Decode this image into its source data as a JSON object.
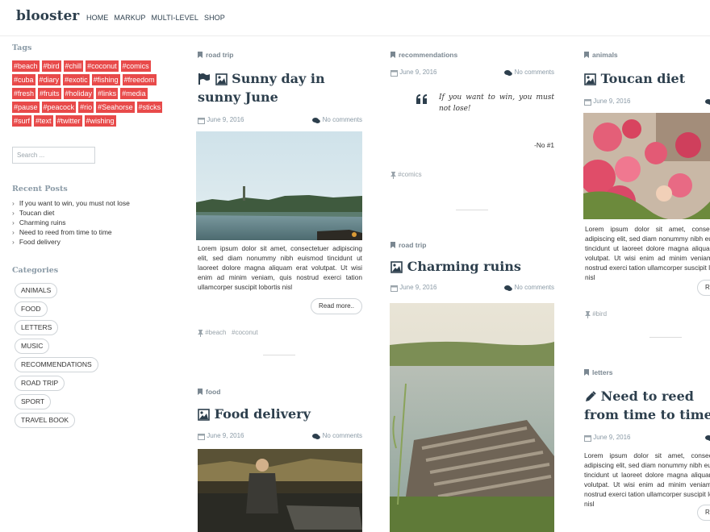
{
  "site": {
    "title": "blooster"
  },
  "nav": [
    "HOME",
    "MARKUP",
    "MULTI-LEVEL",
    "SHOP"
  ],
  "sidebar": {
    "tags_title": "Tags",
    "tags": [
      "#beach",
      "#bird",
      "#chill",
      "#coconut",
      "#comics",
      "#cuba",
      "#diary",
      "#exotic",
      "#fishing",
      "#freedom",
      "#fresh",
      "#fruits",
      "#holiday",
      "#links",
      "#media",
      "#pause",
      "#peacock",
      "#rio",
      "#Seahorse",
      "#sticks",
      "#surf",
      "#text",
      "#twitter",
      "#wishing"
    ],
    "search_placeholder": "Search ...",
    "recent_title": "Recent Posts",
    "recent_posts": [
      "If you want to win, you must not lose",
      "Toucan diet",
      "Charming ruins",
      "Need to reed from time to time",
      "Food delivery"
    ],
    "categories_title": "Categories",
    "categories": [
      "ANIMALS",
      "FOOD",
      "LETTERS",
      "MUSIC",
      "RECOMMENDATIONS",
      "ROAD TRIP",
      "SPORT",
      "TRAVEL BOOK"
    ]
  },
  "posts": {
    "sunny": {
      "category": "road trip",
      "title": "Sunny day in sunny June",
      "date": "June 9, 2016",
      "comments": "No comments",
      "excerpt": "Lorem ipsum dolor sit amet, consectetuer adipiscing elit, sed diam nonummy nibh euismod tincidunt ut laoreet dolore magna aliquam erat volutpat. Ut wisi enim ad minim veniam, quis nostrud exerci tation ullamcorper suscipit lobortis nisl",
      "read_more": "Read more..",
      "tags": [
        "#beach",
        "#coconut"
      ]
    },
    "food": {
      "category": "food",
      "title": "Food delivery",
      "date": "June 9, 2016",
      "comments": "No comments"
    },
    "quote": {
      "category": "recommendations",
      "date": "June 9, 2016",
      "comments": "No comments",
      "text": "If you want to win, you must not lose!",
      "author": "-No #1",
      "tags": [
        "#comics"
      ]
    },
    "ruins": {
      "category": "road trip",
      "title": "Charming ruins",
      "date": "June 9, 2016",
      "comments": "No comments"
    },
    "toucan": {
      "category": "animals",
      "title": "Toucan diet",
      "date": "June 9, 2016",
      "excerpt": "Lorem ipsum dolor sit amet, consectetuer adipiscing elit, sed diam nonummy nibh euismod tincidunt ut laoreet dolore magna aliquam erat volutpat. Ut wisi enim ad minim veniam, quis nostrud exerci tation ullamcorper suscipit lobortis nisl",
      "read_more": "Read more..",
      "tags": [
        "#bird"
      ]
    },
    "reed": {
      "category": "letters",
      "title": "Need to reed from time to time",
      "date": "June 9, 2016",
      "excerpt": "Lorem ipsum dolor sit amet, consectetuer adipiscing elit, sed diam nonummy nibh euismod tincidunt ut laoreet dolore magna aliquam erat volutpat. Ut wisi enim ad minim veniam, quis nostrud exerci tation ullamcorper suscipit lobortis nisl",
      "read_more": "Read more.."
    }
  },
  "colors": {
    "accent": "#e84a4a",
    "heading": "#2d3f4d",
    "muted": "#8a9aa6"
  }
}
